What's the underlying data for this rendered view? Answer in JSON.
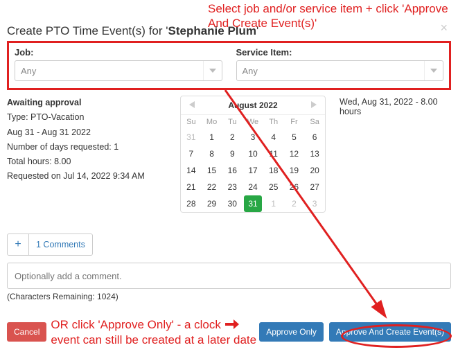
{
  "annotation": {
    "top": "Select job and/or service item + click 'Approve And Create Event(s)'",
    "mid_line1": "OR click 'Approve Only' - a clock",
    "mid_line2": "event can still be created at a later date"
  },
  "modal": {
    "title_prefix": "Create PTO Time Event(s) for '",
    "employee": "Stephanie Plum",
    "title_suffix": "'",
    "close": "×"
  },
  "job": {
    "label": "Job:",
    "value": "Any"
  },
  "service": {
    "label": "Service Item:",
    "value": "Any"
  },
  "details": {
    "status": "Awaiting approval",
    "type": "Type: PTO-Vacation",
    "range": "Aug 31 - Aug 31 2022",
    "numdays": "Number of days requested: 1",
    "hours": "Total hours: 8.00",
    "requested": "Requested on Jul 14, 2022 9:34 AM"
  },
  "calendar": {
    "title": "August 2022",
    "dow": [
      "Su",
      "Mo",
      "Tu",
      "We",
      "Th",
      "Fr",
      "Sa"
    ],
    "weeks": [
      [
        {
          "d": "31",
          "other": true
        },
        {
          "d": "1"
        },
        {
          "d": "2"
        },
        {
          "d": "3"
        },
        {
          "d": "4"
        },
        {
          "d": "5"
        },
        {
          "d": "6"
        }
      ],
      [
        {
          "d": "7"
        },
        {
          "d": "8"
        },
        {
          "d": "9"
        },
        {
          "d": "10"
        },
        {
          "d": "11"
        },
        {
          "d": "12"
        },
        {
          "d": "13"
        }
      ],
      [
        {
          "d": "14"
        },
        {
          "d": "15"
        },
        {
          "d": "16"
        },
        {
          "d": "17"
        },
        {
          "d": "18"
        },
        {
          "d": "19"
        },
        {
          "d": "20"
        }
      ],
      [
        {
          "d": "21"
        },
        {
          "d": "22"
        },
        {
          "d": "23"
        },
        {
          "d": "24"
        },
        {
          "d": "25"
        },
        {
          "d": "26"
        },
        {
          "d": "27"
        }
      ],
      [
        {
          "d": "28"
        },
        {
          "d": "29"
        },
        {
          "d": "30"
        },
        {
          "d": "31",
          "sel": true
        },
        {
          "d": "1",
          "other": true
        },
        {
          "d": "2",
          "other": true
        },
        {
          "d": "3",
          "other": true
        }
      ]
    ]
  },
  "rightinfo": "Wed, Aug 31, 2022 - 8.00 hours",
  "comments": {
    "plus": "+",
    "link": "1 Comments",
    "placeholder": "Optionally add a comment.",
    "chars": "(Characters Remaining: 1024)"
  },
  "buttons": {
    "cancel": "Cancel",
    "approve_only": "Approve Only",
    "approve_create": "Approve And Create Event(s)"
  }
}
